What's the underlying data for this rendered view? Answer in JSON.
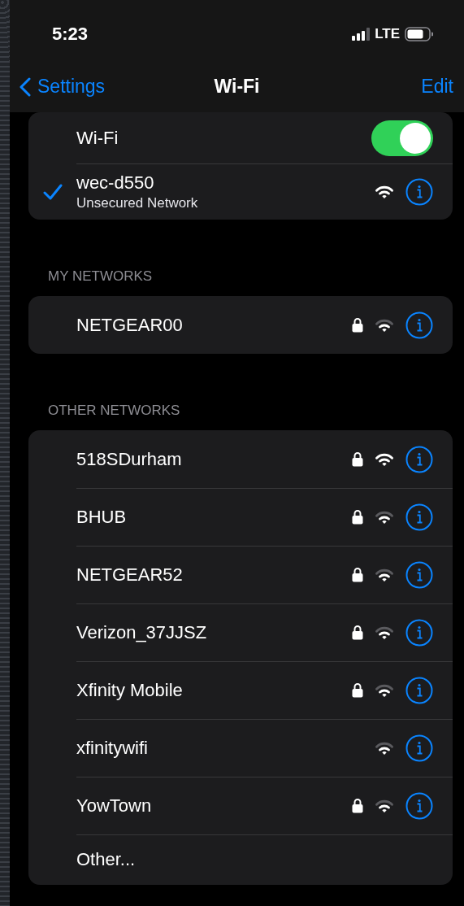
{
  "status_bar": {
    "time": "5:23",
    "network": "LTE"
  },
  "nav": {
    "back": "Settings",
    "title": "Wi-Fi",
    "action": "Edit"
  },
  "wifi": {
    "label": "Wi-Fi",
    "on": true
  },
  "current": {
    "name": "wec-d550",
    "subtitle": "Unsecured Network",
    "connected": true,
    "locked": false,
    "strong": true
  },
  "sections": [
    {
      "header": "MY NETWORKS",
      "networks": [
        {
          "name": "NETGEAR00",
          "locked": true,
          "strong": false
        }
      ]
    },
    {
      "header": "OTHER NETWORKS",
      "networks": [
        {
          "name": "518SDurham",
          "locked": true,
          "strong": true
        },
        {
          "name": "BHUB",
          "locked": true,
          "strong": false
        },
        {
          "name": "NETGEAR52",
          "locked": true,
          "strong": false
        },
        {
          "name": "Verizon_37JJSZ",
          "locked": true,
          "strong": false
        },
        {
          "name": "Xfinity Mobile",
          "locked": true,
          "strong": false
        },
        {
          "name": "xfinitywifi",
          "locked": false,
          "strong": false
        },
        {
          "name": "YowTown",
          "locked": true,
          "strong": false
        }
      ],
      "other": "Other..."
    }
  ]
}
